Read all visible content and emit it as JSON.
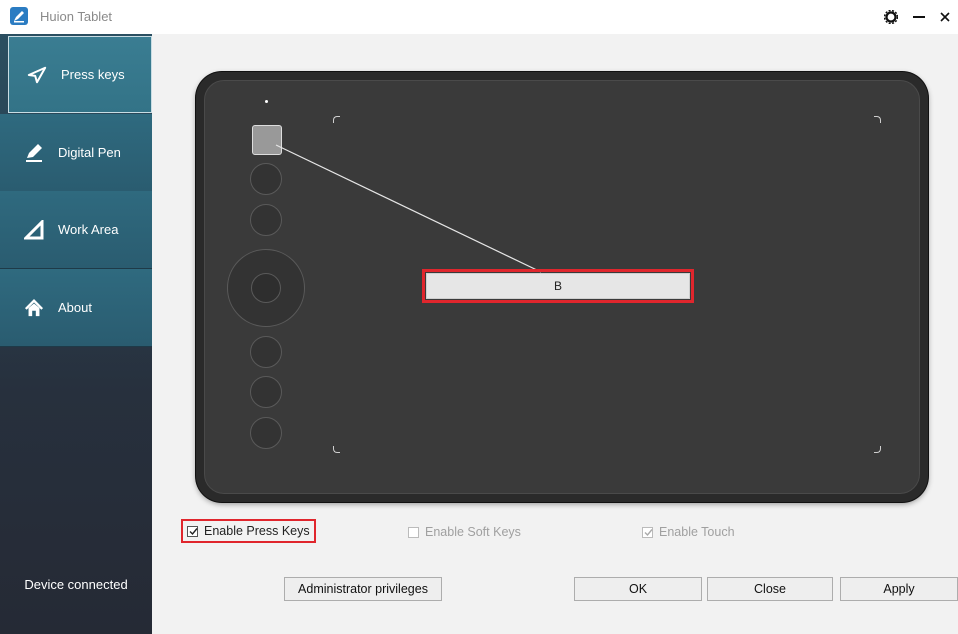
{
  "window": {
    "title": "Huion Tablet"
  },
  "sidebar": {
    "items": [
      {
        "label": "Press keys",
        "icon": "send-arrow-icon",
        "active": true
      },
      {
        "label": "Digital Pen",
        "icon": "pen-icon",
        "active": false
      },
      {
        "label": "Work Area",
        "icon": "triangle-area-icon",
        "active": false
      },
      {
        "label": "About",
        "icon": "home-icon",
        "active": false
      }
    ],
    "status": "Device connected"
  },
  "tablet": {
    "selected_key_assignment": "B"
  },
  "options": {
    "enable_press_keys": {
      "label": "Enable Press Keys",
      "checked": true,
      "enabled": true
    },
    "enable_soft_keys": {
      "label": "Enable Soft Keys",
      "checked": false,
      "enabled": false
    },
    "enable_touch": {
      "label": "Enable Touch",
      "checked": true,
      "enabled": false
    }
  },
  "buttons": {
    "admin": "Administrator privileges",
    "ok": "OK",
    "close": "Close",
    "apply": "Apply"
  },
  "colors": {
    "accent_red": "#e0262d",
    "sidebar_teal": "#2f6a7f"
  }
}
